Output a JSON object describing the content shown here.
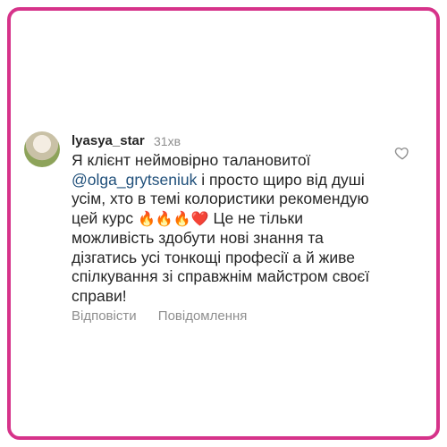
{
  "comment": {
    "username": "lyasya_star",
    "time": "31хв",
    "text_line1": "Я клієнт неймовірно талановитої",
    "mention": "@olga_grytseniuk",
    "text_after_mention": "  і просто щиро від душі усім, хто в темі колористики рекомендую цей курс ",
    "emojis": "🔥🔥🔥❤️",
    "text_end": " Це не тільки можливість здобути нові знання та дізгатись усі тонкощі професії а й живе  спілкування зі справжнім майстром своєї справи!",
    "reply_label": "Відповісти",
    "message_label": "Повідомлення"
  },
  "icons": {
    "like": "heart-outline-icon"
  },
  "colors": {
    "frame_border": "#d6338a",
    "username": "#262626",
    "secondary_text": "#8e8e8e",
    "mention": "#1f4f7a"
  }
}
